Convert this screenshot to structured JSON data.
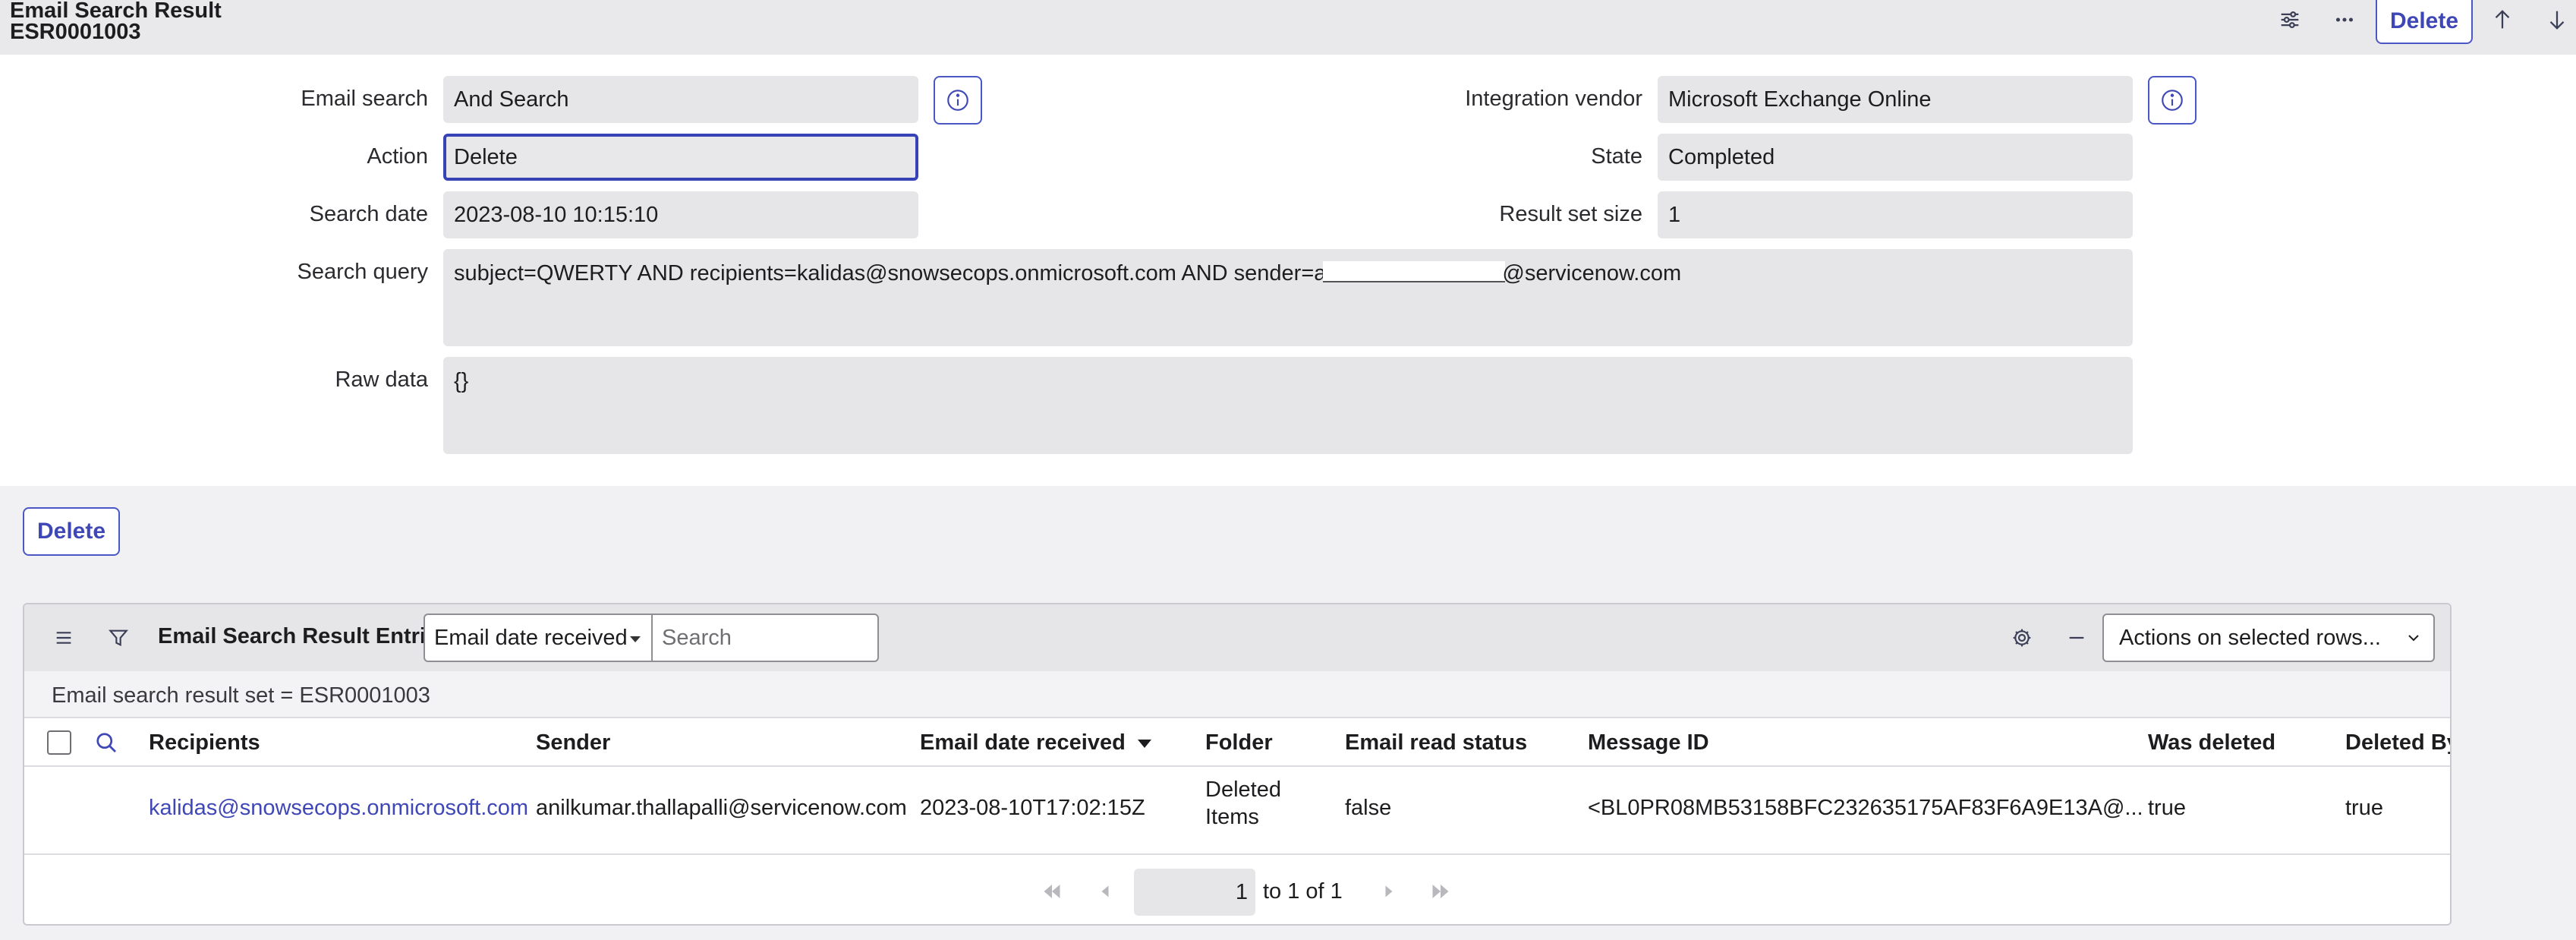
{
  "header": {
    "title": "Email Search Result",
    "number": "ESR0001003",
    "delete_label": "Delete",
    "icons": [
      "sliders-icon",
      "more-icon",
      "arrow-up-icon",
      "arrow-down-icon"
    ]
  },
  "form": {
    "email_search": {
      "label": "Email search",
      "value": "And Search"
    },
    "action": {
      "label": "Action",
      "value": "Delete"
    },
    "search_date": {
      "label": "Search date",
      "value": "2023-08-10 10:15:10"
    },
    "search_query": {
      "label": "Search query",
      "value_prefix": "subject=QWERTY AND recipients=kalidas@snowsecops.onmicrosoft.com AND sender=a",
      "value_suffix": "@servicenow.com"
    },
    "raw_data": {
      "label": "Raw data",
      "value": "{}"
    },
    "integration_vendor": {
      "label": "Integration vendor",
      "value": "Microsoft Exchange Online"
    },
    "state": {
      "label": "State",
      "value": "Completed"
    },
    "result_set_size": {
      "label": "Result set size",
      "value": "1"
    }
  },
  "delete_button_label": "Delete",
  "list": {
    "title": "Email Search Result Entries",
    "search_field": "Email date received",
    "search_placeholder": "Search",
    "actions_label": "Actions on selected rows...",
    "filter_text": "Email search result set = ESR0001003",
    "columns": [
      "Recipients",
      "Sender",
      "Email date received",
      "Folder",
      "Email read status",
      "Message ID",
      "Was deleted",
      "Deleted By"
    ],
    "rows": [
      {
        "recipients": "kalidas@snowsecops.onmicrosoft.com",
        "sender": "anilkumar.thallapalli@servicenow.com",
        "email_date_received": "2023-08-10T17:02:15Z",
        "folder": "Deleted Items",
        "email_read_status": "false",
        "message_id": "<BL0PR08MB53158BFC232635175AF83F6A9E13A@...",
        "was_deleted": "true",
        "deleted_by": "true"
      }
    ],
    "pager": {
      "page": "1",
      "range_text": "to 1 of 1"
    }
  },
  "colors": {
    "accent": "#3f47b7",
    "header_bg": "#e9e9ec",
    "field_bg": "#e6e6e9"
  }
}
